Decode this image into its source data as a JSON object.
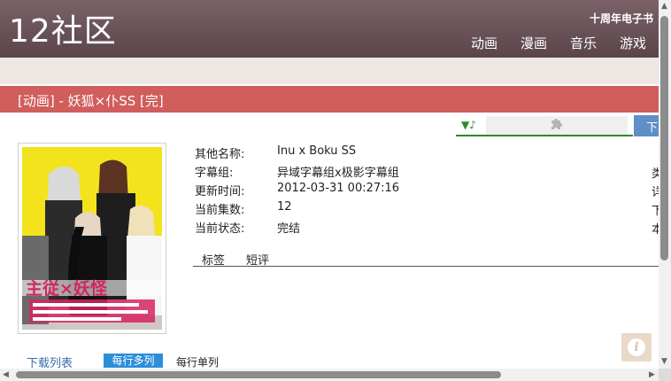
{
  "header": {
    "logo": "12社区",
    "anniversary": "十周年电子书",
    "nav": [
      "动画",
      "漫画",
      "音乐",
      "游戏"
    ]
  },
  "title": "[动画] - 妖狐×仆SS [完]",
  "player": {
    "mark": "▼♪",
    "download_tab": "下"
  },
  "info": {
    "rows": [
      {
        "key": "其他名称:",
        "value": "Inu x Boku SS"
      },
      {
        "key": "字幕组:",
        "value": "异域字幕组x极影字幕组"
      },
      {
        "key": "更新时间:",
        "value": "2012-03-31 00:27:16"
      },
      {
        "key": "当前集数:",
        "value": "12"
      },
      {
        "key": "当前状态:",
        "value": "完结"
      }
    ],
    "right_column": [
      "类",
      "详",
      "下",
      "本"
    ]
  },
  "tabs": [
    "标签",
    "短评"
  ],
  "download": {
    "title": "下载列表",
    "multi_label": "每行多列",
    "single_label": "每行单列"
  },
  "poster": {
    "title_text": "主従×妖怪"
  },
  "info_button": "i",
  "colors": {
    "header": "#6b5459",
    "title_bar": "#d15d5d",
    "accent_blue": "#2d8ed8",
    "player_green": "#2e8a2e"
  }
}
